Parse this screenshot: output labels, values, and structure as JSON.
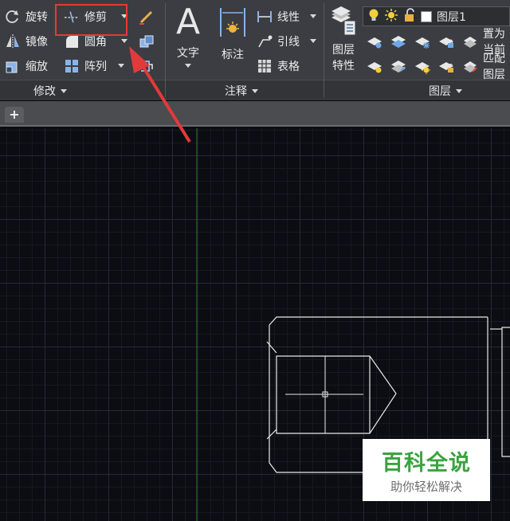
{
  "modify_panel": {
    "rotate_label": "旋转",
    "mirror_label": "镜像",
    "scale_label": "缩放",
    "trim_label": "修剪",
    "fillet_label": "圆角",
    "array_label": "阵列",
    "footer_label": "修改"
  },
  "annotation_panel": {
    "text_label": "文字",
    "dimension_label": "标注",
    "linear_label": "线性",
    "leader_label": "引线",
    "table_label": "表格",
    "footer_label": "注释"
  },
  "layers_panel": {
    "properties_label_1": "图层",
    "properties_label_2": "特性",
    "current_layer": "图层1",
    "set_current_label": "置为当前",
    "match_label": "匹配图层",
    "footer_label": "图层"
  },
  "tabs": {
    "add_tab_label": "+"
  },
  "watermark": {
    "title": "百科全说",
    "subtitle": "助你轻松解决"
  },
  "colors": {
    "ribbon": "#3b3d42",
    "canvas": "#0b0d12",
    "highlight": "#e23a3a",
    "drawing_lines": "#e8e8e8",
    "ucs_axis": "#2f6a2f",
    "watermark_green": "#3aa33f"
  }
}
